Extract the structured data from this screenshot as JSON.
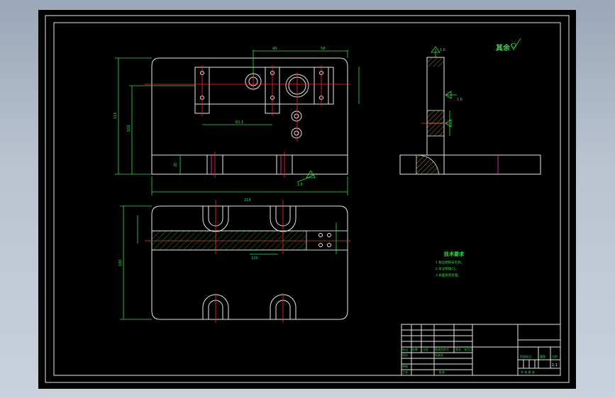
{
  "roughness_note": "其余",
  "dims": {
    "top_width": "40",
    "top_right": "58",
    "overall_width": "218",
    "left_height": "115",
    "left_height_inner": "100",
    "slot_dim": "R1.1",
    "base_height": "35",
    "roughness_base": "1.6",
    "side_top": "1.6",
    "side_mid": "1.6",
    "bottom_height": "100",
    "bottom_bot": "120"
  },
  "tech_req": {
    "title": "技术要求",
    "lines": [
      "1.锐边倒钝去毛刺。",
      "2.未注倒角C1。",
      "3.表面发黑处理。"
    ]
  },
  "title_block": {
    "labels": [
      "标记",
      "处数",
      "分区",
      "更改文件号",
      "签名",
      "年月日",
      "设计",
      "标准化",
      "审核",
      "工艺",
      "批准"
    ],
    "stage": "阶段标记",
    "weight": "重量",
    "scale": "比例",
    "scale_value": "1:1",
    "sheet": "共 张 第 张"
  }
}
